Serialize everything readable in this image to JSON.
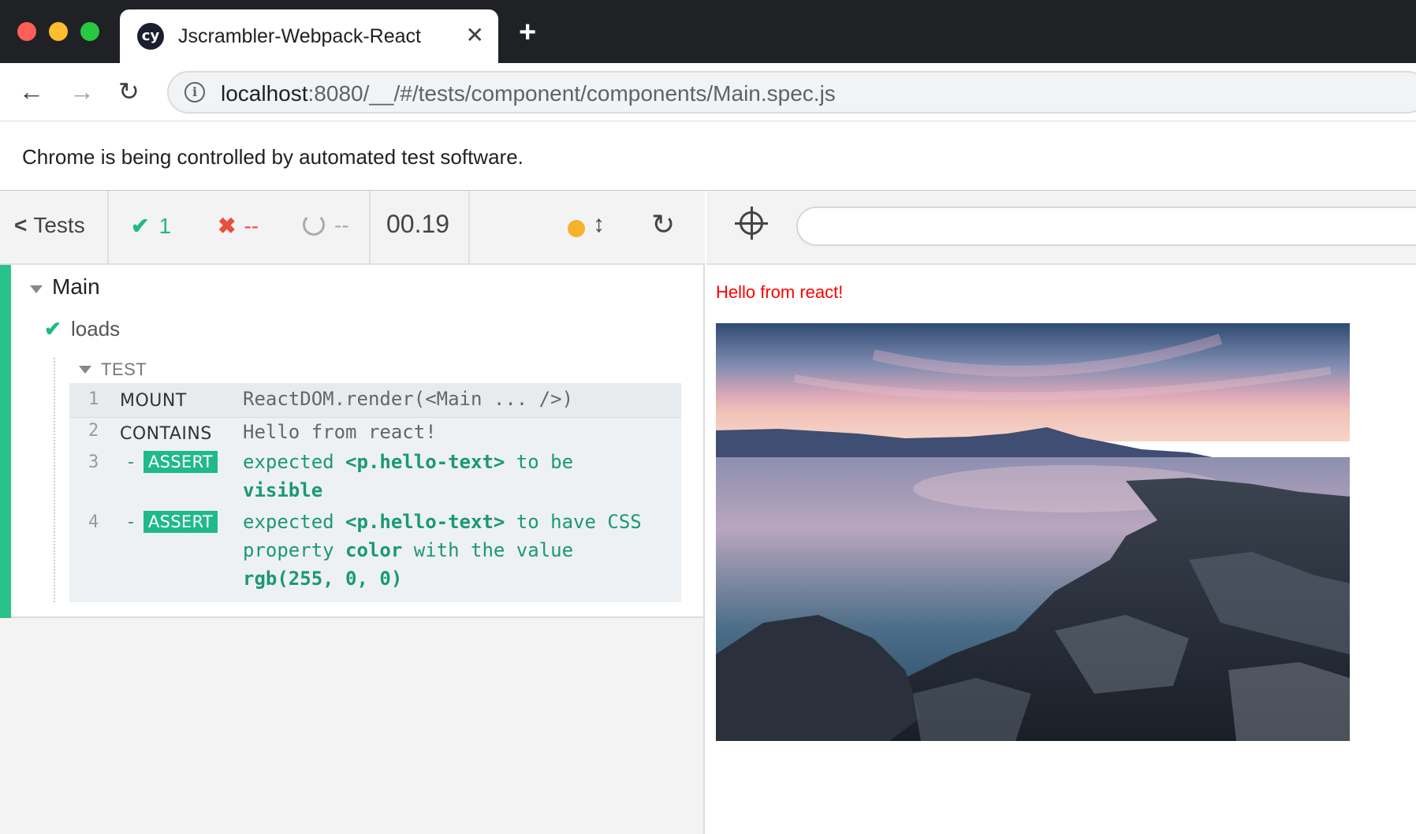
{
  "browser": {
    "tab_title": "Jscrambler-Webpack-React",
    "favicon_text": "cy",
    "url_host": "localhost",
    "url_rest": ":8080/__/#/tests/component/components/Main.spec.js",
    "infobar_text": "Chrome is being controlled by automated test software."
  },
  "reporter": {
    "tests_label": "Tests",
    "passed": "1",
    "failed": "--",
    "pending": "--",
    "duration": "00.19",
    "suite": {
      "title": "Main",
      "test": {
        "title": "loads",
        "hook_title": "TEST",
        "commands": [
          {
            "num": "1",
            "name": "MOUNT",
            "message": "ReactDOM.render(<Main ... />)"
          },
          {
            "num": "2",
            "name": "CONTAINS",
            "message": "Hello from react!"
          },
          {
            "num": "3",
            "name": "ASSERT",
            "dash": "-",
            "msg_a": "expected",
            "msg_b": "<p.hello-text>",
            "msg_c": "to be",
            "msg_d": "visible"
          },
          {
            "num": "4",
            "name": "ASSERT",
            "dash": "-",
            "msg_a": "expected",
            "msg_b": "<p.hello-text>",
            "msg_c": "to have CSS",
            "msg_d": "property",
            "msg_e": "color",
            "msg_f": "with the value",
            "msg_g": "rgb(255, 0, 0)"
          }
        ]
      }
    }
  },
  "aut": {
    "hello_text": "Hello from react!",
    "image_subject": "coastal-sunset-rocky-shore"
  },
  "colors": {
    "pass": "#1fb98a",
    "fail": "#e94f3d",
    "hello": "#ff0000",
    "running_dot": "#f4b32b"
  }
}
